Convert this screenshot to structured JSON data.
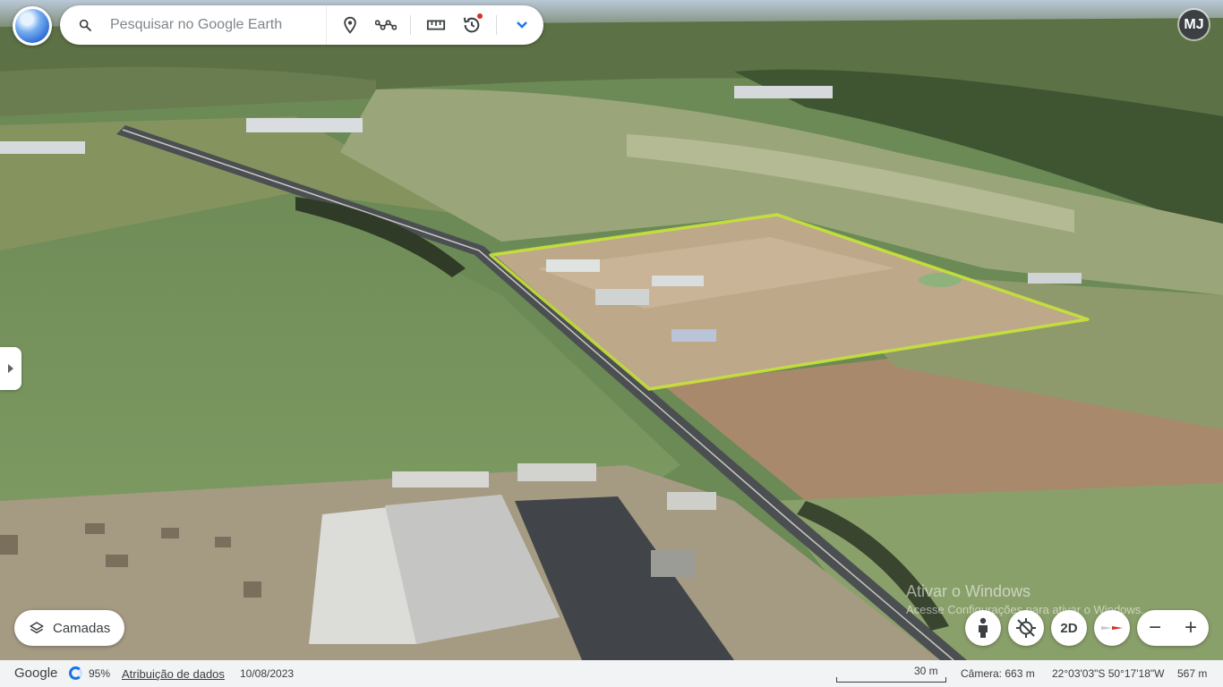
{
  "search": {
    "placeholder": "Pesquisar no Google Earth"
  },
  "toolbar_icons": [
    "search-icon",
    "place-pin-icon",
    "path-icon",
    "ruler-icon",
    "history-icon",
    "chevron-down-icon"
  ],
  "user": {
    "initials": "MJ"
  },
  "bottom": {
    "layers_label": "Camadas",
    "view_mode_label": "2D",
    "zoom_out": "−",
    "zoom_in": "+"
  },
  "watermark": {
    "title": "Ativar o Windows",
    "subtitle": "Acesse Configurações para ativar o Windows."
  },
  "status": {
    "brand": "Google",
    "loading_percent": "95%",
    "attribution": "Atribuição de dados",
    "date": "10/08/2023",
    "scale": "30 m",
    "camera": "Câmera: 663 m",
    "coordinates": "22°03'03\"S 50°17'18\"W",
    "elevation": "567 m"
  },
  "colors": {
    "accent": "#1a73e8",
    "polygon_outline": "#c8e23a",
    "notification_dot": "#d93025"
  }
}
